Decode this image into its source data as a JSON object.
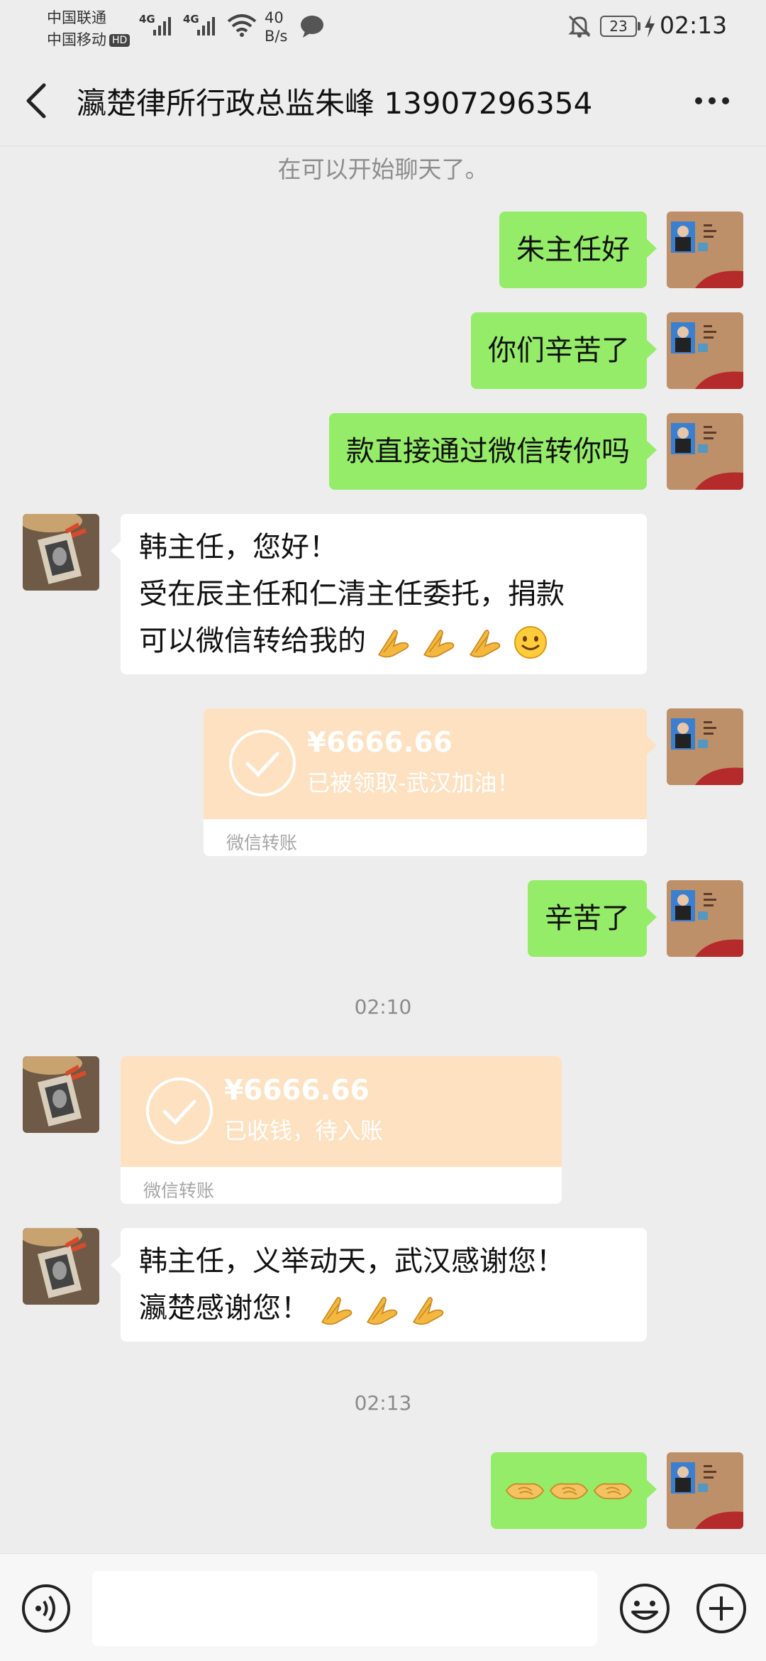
{
  "status_bar": {
    "carrier_1": "中国联通",
    "carrier_2": "中国移动",
    "hd_badge": "HD",
    "net_1": "4G",
    "net_2": "4G",
    "speed_value": "40",
    "speed_unit": "B/s",
    "battery": "23",
    "time": "02:13"
  },
  "header": {
    "title": "瀛楚律所行政总监朱峰 13907296354"
  },
  "messages": {
    "system_notice": "在可以开始聊天了。",
    "out_1": "朱主任好",
    "out_2": "你们辛苦了",
    "out_3": "款直接通过微信转你吗",
    "in_1_line_1": "韩主任，您好！",
    "in_1_line_2": "受在辰主任和仁清主任委托，捐款",
    "in_1_line_3": "可以微信转给我的",
    "transfer_1": {
      "amount": "¥6666.66",
      "status": "已被领取-武汉加油！",
      "footer": "微信转账"
    },
    "out_4": "辛苦了",
    "time_1": "02:10",
    "transfer_2": {
      "amount": "¥6666.66",
      "status": "已收钱，待入账",
      "footer": "微信转账"
    },
    "in_2_line_1": "韩主任，义举动天，武汉感谢您！",
    "in_2_line_2": "瀛楚感谢您！",
    "time_2": "02:13"
  },
  "icons": {
    "pray": "folded-hands-emoji",
    "smile": "smiling-face-emoji",
    "handshake": "handshake-emoji",
    "back": "chevron-left-icon",
    "more": "more-dots-icon",
    "voice": "voice-icon",
    "emoji": "emoji-icon",
    "plus": "plus-icon"
  },
  "colors": {
    "outgoing_bubble": "#95ec69",
    "incoming_bubble": "#ffffff",
    "transfer_card": "#fde1c0",
    "background": "#ededed"
  }
}
